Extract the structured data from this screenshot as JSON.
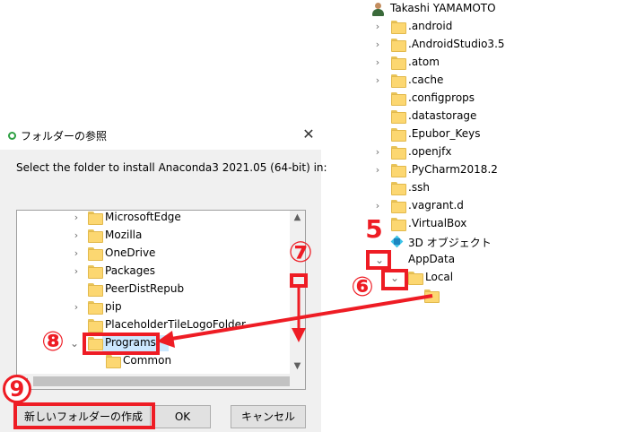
{
  "explorer": {
    "user": "Takashi YAMAMOTO",
    "items": [
      {
        "label": ".android",
        "chevron": "›"
      },
      {
        "label": ".AndroidStudio3.5",
        "chevron": "›"
      },
      {
        "label": ".atom",
        "chevron": "›"
      },
      {
        "label": ".cache",
        "chevron": "›"
      },
      {
        "label": ".configprops",
        "chevron": ""
      },
      {
        "label": ".datastorage",
        "chevron": ""
      },
      {
        "label": ".Epubor_Keys",
        "chevron": ""
      },
      {
        "label": ".openjfx",
        "chevron": "›"
      },
      {
        "label": ".PyCharm2018.2",
        "chevron": "›"
      },
      {
        "label": ".ssh",
        "chevron": ""
      },
      {
        "label": ".vagrant.d",
        "chevron": "›"
      },
      {
        "label": ".VirtualBox",
        "chevron": ""
      }
    ],
    "objects3d": "3D オブジェクト",
    "appdata": "AppData",
    "local": "Local"
  },
  "dialog": {
    "title": "フォルダーの参照",
    "close": "✕",
    "prompt": "Select the folder to install Anaconda3 2021.05 (64-bit) in:",
    "folders": [
      {
        "label": "MicrosoftEdge",
        "chevron": "›"
      },
      {
        "label": "Mozilla",
        "chevron": "›"
      },
      {
        "label": "OneDrive",
        "chevron": "›"
      },
      {
        "label": "Packages",
        "chevron": "›"
      },
      {
        "label": "PeerDistRepub",
        "chevron": ""
      },
      {
        "label": "pip",
        "chevron": "›"
      },
      {
        "label": "PlaceholderTileLogoFolder",
        "chevron": ""
      },
      {
        "label": "Programs",
        "chevron": "⌄"
      },
      {
        "label": "Common",
        "chevron": ""
      }
    ],
    "buttons": {
      "new_folder": "新しいフォルダーの作成(N)",
      "ok": "OK",
      "cancel": "キャンセル"
    }
  },
  "annotations": {
    "n5": "5",
    "n6": "⑥",
    "n7": "⑦",
    "n8": "⑧",
    "n9": "9",
    "color": "#ee1c24"
  }
}
